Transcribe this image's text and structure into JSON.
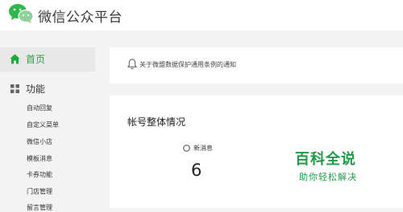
{
  "header": {
    "logo_icon": "wechat-logo",
    "title": "微信公众平台"
  },
  "sidebar": {
    "home": {
      "label": "首页",
      "icon": "home-icon",
      "active": true
    },
    "function_group": {
      "label": "功能",
      "icon": "grid-icon"
    },
    "items": [
      {
        "label": "自动回复"
      },
      {
        "label": "自定义菜单"
      },
      {
        "label": "微信小店"
      },
      {
        "label": "模板消息"
      },
      {
        "label": "卡券功能"
      },
      {
        "label": "门店管理"
      },
      {
        "label": "留言管理"
      }
    ]
  },
  "notice": {
    "icon": "bell-icon",
    "text": "关于微盟数据保护通用条例的通知"
  },
  "overview": {
    "title": "帐号整体情况",
    "new_messages": {
      "label": "新消息",
      "value": "6",
      "icon": "circle-icon"
    }
  },
  "watermark": {
    "title": "百科全说",
    "subtitle": "助你轻松解决"
  },
  "colors": {
    "accent_green": "#20a83a",
    "watermark_green": "#1f9a48",
    "page_background": "#f3f3f3",
    "panel_background": "#ffffff",
    "active_nav_background": "#e8e8e8"
  }
}
